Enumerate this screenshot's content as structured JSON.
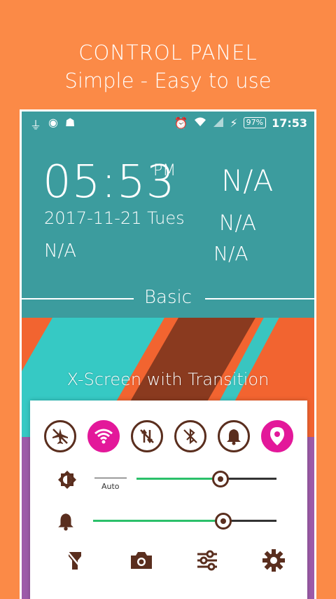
{
  "promo": {
    "title": "CONTROL PANEL",
    "subtitle": "Simple - Easy to use"
  },
  "statusbar": {
    "left_icons": [
      "usb-icon",
      "camera-app-icon",
      "android-icon"
    ],
    "right_icons": [
      "alarm-icon",
      "wifi-icon",
      "signal-icon",
      "charging-icon"
    ],
    "battery": "97%",
    "time": "17:53"
  },
  "widget": {
    "clock": "05:53",
    "ampm": "PM",
    "date": "2017-11-21 Tues",
    "na_big": "N/A",
    "na_1": "N/A",
    "na_2": "N/A",
    "na_3": "N/A",
    "section_label": "Basic"
  },
  "wallpaper": {
    "label": "X-Screen with Transition"
  },
  "control_panel": {
    "toggles": [
      {
        "name": "airplane-toggle",
        "icon": "airplane-off-icon",
        "on": false
      },
      {
        "name": "wifi-toggle",
        "icon": "wifi-icon",
        "on": true
      },
      {
        "name": "mobile-data-toggle",
        "icon": "mobile-data-off-icon",
        "on": false
      },
      {
        "name": "bluetooth-toggle",
        "icon": "bluetooth-off-icon",
        "on": false
      },
      {
        "name": "sound-toggle",
        "icon": "bell-icon",
        "on": false
      },
      {
        "name": "location-toggle",
        "icon": "location-icon",
        "on": true
      }
    ],
    "brightness": {
      "auto_label": "Auto",
      "level": 0.6
    },
    "volume": {
      "level": 0.71
    },
    "bottom_icons": [
      "flashlight-icon",
      "camera-icon",
      "settings-sliders-icon",
      "gear-icon"
    ],
    "colors": {
      "accent": "#E3189A",
      "track": "#2BC06A",
      "icon": "#5A2E1E"
    }
  }
}
